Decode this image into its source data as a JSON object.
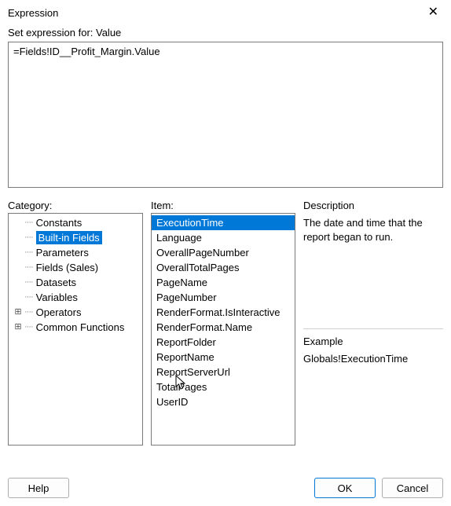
{
  "window": {
    "title": "Expression",
    "close_glyph": "✕"
  },
  "labels": {
    "set_expression_for": "Set expression for: Value",
    "category": "Category:",
    "item": "Item:",
    "description": "Description",
    "example": "Example"
  },
  "expression": {
    "value": "=Fields!ID__Profit_Margin.Value"
  },
  "category": {
    "items": [
      {
        "label": "Constants",
        "expandable": false
      },
      {
        "label": "Built-in Fields",
        "expandable": false,
        "selected": true
      },
      {
        "label": "Parameters",
        "expandable": false
      },
      {
        "label": "Fields (Sales)",
        "expandable": false
      },
      {
        "label": "Datasets",
        "expandable": false
      },
      {
        "label": "Variables",
        "expandable": false
      },
      {
        "label": "Operators",
        "expandable": true
      },
      {
        "label": "Common Functions",
        "expandable": true
      }
    ]
  },
  "item_list": {
    "items": [
      {
        "label": "ExecutionTime",
        "selected": true
      },
      {
        "label": "Language"
      },
      {
        "label": "OverallPageNumber"
      },
      {
        "label": "OverallTotalPages"
      },
      {
        "label": "PageName"
      },
      {
        "label": "PageNumber"
      },
      {
        "label": "RenderFormat.IsInteractive"
      },
      {
        "label": "RenderFormat.Name"
      },
      {
        "label": "ReportFolder"
      },
      {
        "label": "ReportName"
      },
      {
        "label": "ReportServerUrl"
      },
      {
        "label": "TotalPages"
      },
      {
        "label": "UserID"
      }
    ]
  },
  "description": {
    "text": "The date and time that the report began to run."
  },
  "example": {
    "text": "Globals!ExecutionTime"
  },
  "buttons": {
    "help": "Help",
    "ok": "OK",
    "cancel": "Cancel"
  }
}
